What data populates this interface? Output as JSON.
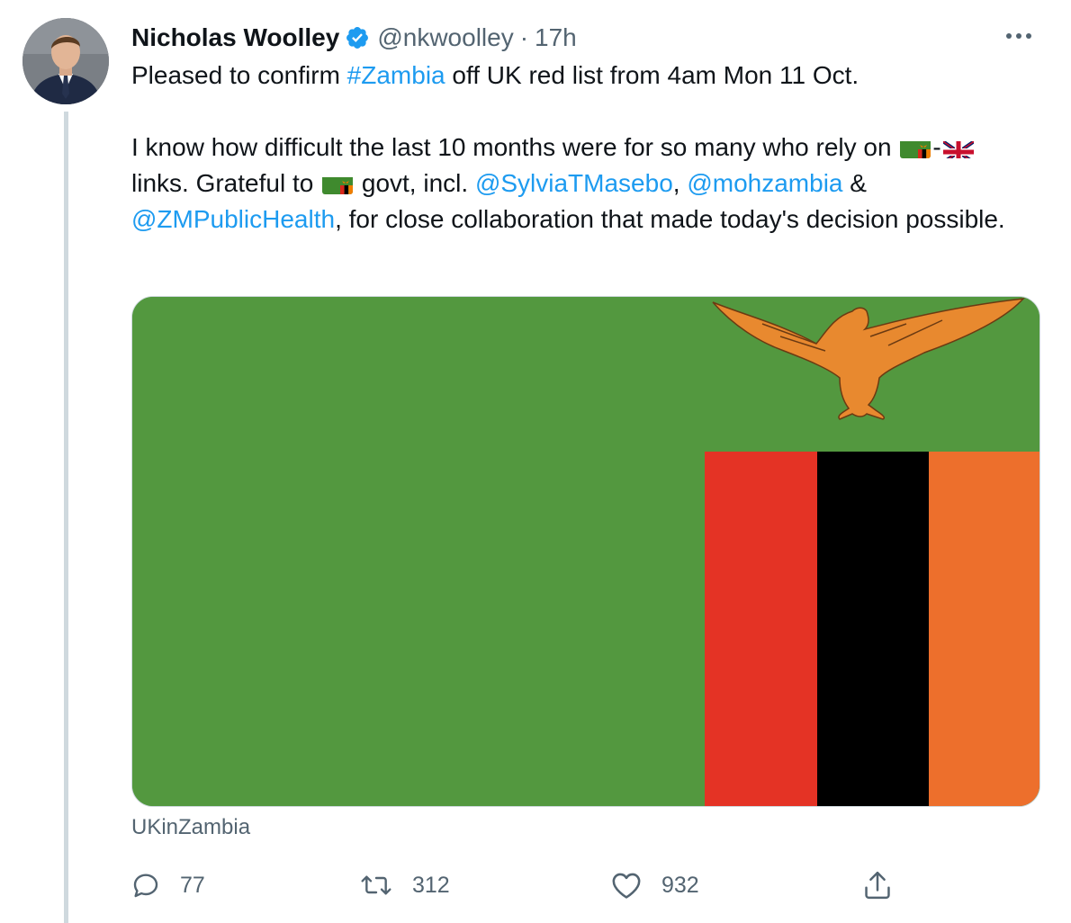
{
  "tweet": {
    "author_name": "Nicholas Woolley",
    "handle": "@nkwoolley",
    "separator": "·",
    "time": "17h",
    "text": {
      "p1_before": "Pleased to confirm ",
      "p1_hashtag": "#Zambia",
      "p1_after": " off UK red list from 4am Mon 11 Oct.",
      "p2_a": "I know how difficult the last 10 months were for so many who rely on ",
      "p2_dash": "-",
      "p2_b": " links. Grateful to ",
      "p2_c": " govt, incl. ",
      "mention_1": "@SylviaTMasebo",
      "p2_d": ", ",
      "mention_2": "@mohzambia",
      "p2_e": " & ",
      "mention_3": "@ZMPublicHealth",
      "p2_f": ", for close collaboration that made today's decision possible."
    },
    "media_source": "UKinZambia",
    "stats": {
      "replies": "77",
      "retweets": "312",
      "likes": "932"
    }
  },
  "icons": {
    "verified": "verified-badge-icon",
    "more": "more-options-icon",
    "reply": "reply-icon",
    "retweet": "retweet-icon",
    "like": "heart-icon",
    "share": "share-icon",
    "flag_zambia": "zambia-flag-icon",
    "flag_uk": "uk-flag-icon"
  },
  "colors": {
    "link": "#1d9bf0",
    "secondary_text": "#536471",
    "verified": "#1d9bf0",
    "flag_green": "#53983f",
    "flag_red": "#e43325",
    "flag_black": "#000000",
    "flag_orange": "#ed6f2c",
    "eagle": "#e8892f"
  }
}
